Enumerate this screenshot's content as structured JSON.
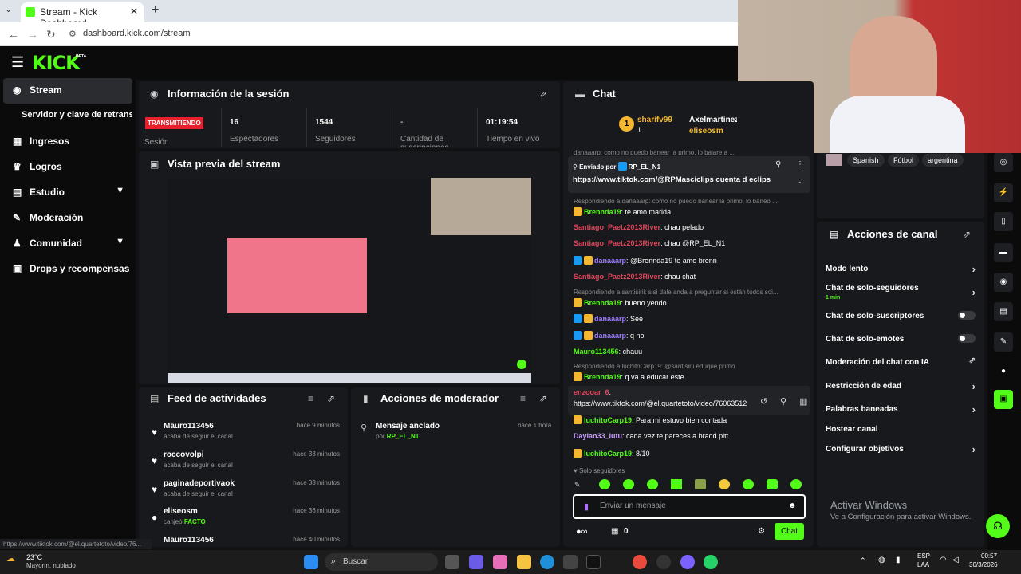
{
  "browser": {
    "tab_title": "Stream - Kick Dashboard",
    "url": "dashboard.kick.com/stream",
    "new_tab": "+",
    "close": "✕"
  },
  "header": {
    "logo": "KICK",
    "beta": "BETA"
  },
  "sidebar": {
    "items": [
      {
        "label": "Stream",
        "icon": "broadcast-icon"
      },
      {
        "label": "Servidor y clave de retransn"
      },
      {
        "label": "Ingresos"
      },
      {
        "label": "Logros"
      },
      {
        "label": "Estudio"
      },
      {
        "label": "Moderación"
      },
      {
        "label": "Comunidad"
      },
      {
        "label": "Drops y recompensas"
      }
    ]
  },
  "session": {
    "title": "Información de la sesión",
    "status": "TRANSMITIENDO",
    "status_label": "Sesión",
    "viewers": "16",
    "viewers_label": "Espectadores",
    "followers": "1544",
    "followers_label": "Seguidores",
    "subs": "-",
    "subs_label": "Cantidad de suscripciones",
    "time": "01:19:54",
    "time_label": "Tiempo en vivo"
  },
  "preview": {
    "title": "Vista previa del stream"
  },
  "feed": {
    "title": "Feed de actividades",
    "items": [
      {
        "name": "Mauro113456",
        "sub": "acaba de seguir el canal",
        "time": "hace 9 minutos"
      },
      {
        "name": "roccovolpi",
        "sub": "acaba de seguir el canal",
        "time": "hace 33 minutos"
      },
      {
        "name": "paginadeportivaok",
        "sub": "acaba de seguir el canal",
        "time": "hace 33 minutos"
      },
      {
        "name": "eliseosm",
        "sub": "canjeó",
        "sub2": "FACTO",
        "time": "hace 36 minutos"
      },
      {
        "name": "Mauro113456",
        "sub": "",
        "time": "hace 40 minutos"
      }
    ]
  },
  "modactions": {
    "title": "Acciones de moderador",
    "pinned": "Mensaje anclado",
    "by": "por",
    "by_user": "RP_EL_N1",
    "time": "hace 1 hora"
  },
  "chat": {
    "title": "Chat",
    "top1": "sharifv99",
    "top1_count": "1",
    "top2": "Axelmartinezr",
    "top3": "eliseosm",
    "pinned_by": "Enviado por",
    "pinned_user": "RP_EL_N1",
    "pinned_link": "https://www.tiktok.com/@RPMasciclips",
    "pinned_text": "cuenta d eclips",
    "truncated_top": "danaaarp: como no puedo banear la primo, lo bajare a ...",
    "messages": [
      {
        "type": "reply",
        "text": "Respondiendo a danaaarp: como no puedo banear la primo, lo baneo ..."
      },
      {
        "user": "Brennda19",
        "color": "#53fc18",
        "text": "te amo marida",
        "badges": "crown"
      },
      {
        "user": "Santiago_Paetz2013River",
        "color": "#e0455b",
        "text": "chau pelado"
      },
      {
        "user": "Santiago_Paetz2013River",
        "color": "#e0455b",
        "text": "chau @RP_EL_N1"
      },
      {
        "user": "danaaarp",
        "color": "#9d7cff",
        "text": "@Brennda19 te amo brenn",
        "badges": "both"
      },
      {
        "user": "Santiago_Paetz2013River",
        "color": "#e0455b",
        "text": "chau chat"
      },
      {
        "type": "reply",
        "text": "Respondiendo a santisirii: sisi dale anda a preguntar si están todos soi..."
      },
      {
        "user": "Brennda19",
        "color": "#53fc18",
        "text": "bueno yendo",
        "badges": "crown"
      },
      {
        "user": "danaaarp",
        "color": "#9d7cff",
        "text": "See",
        "badges": "both"
      },
      {
        "user": "danaaarp",
        "color": "#9d7cff",
        "text": "q no",
        "badges": "both"
      },
      {
        "user": "Mauro113456",
        "color": "#53fc18",
        "text": "chauu"
      },
      {
        "type": "reply",
        "text": "Respondiendo a luchitoCarp19: @santisirii eduque primo"
      },
      {
        "user": "Brennda19",
        "color": "#53fc18",
        "text": "q va a educar este",
        "badges": "crown"
      },
      {
        "user": "enzooar_6",
        "color": "#e0455b",
        "text": ""
      },
      {
        "type": "link",
        "text": "https://www.tiktok.com/@el.quartetoto/video/76063512"
      },
      {
        "user": "luchitoCarp19",
        "color": "#53fc18",
        "text": "Para mi estuvo bien contada",
        "badges": "crown"
      },
      {
        "user": "Daylan33_iutu",
        "color": "#c79cff",
        "text": "cada vez te pareces a bradd pitt"
      },
      {
        "user": "luchitoCarp19",
        "color": "#53fc18",
        "text": "8/10",
        "badges": "crown"
      }
    ],
    "followers_only": "Solo seguidores",
    "placeholder": "Enviar un mensaje",
    "points": "0",
    "send": "Chat"
  },
  "tags": [
    "Spanish",
    "Fútbol",
    "argentina"
  ],
  "channel_actions": {
    "title": "Acciones de canal",
    "items": [
      {
        "label": "Modo lento",
        "ctrl": "chevron"
      },
      {
        "label": "Chat de solo-seguidores",
        "sub": "1 min",
        "ctrl": "chevron"
      },
      {
        "label": "Chat de solo-suscriptores",
        "ctrl": "toggle"
      },
      {
        "label": "Chat de solo-emotes",
        "ctrl": "toggle"
      },
      {
        "label": "Moderación del chat con IA",
        "ctrl": "ext"
      },
      {
        "label": "Restricción de edad",
        "ctrl": "chevron"
      },
      {
        "label": "Palabras baneadas",
        "ctrl": "chevron"
      },
      {
        "label": "Hostear canal",
        "ctrl": "none"
      },
      {
        "label": "Configurar objetivos",
        "ctrl": "chevron"
      }
    ]
  },
  "windows": {
    "activate_title": "Activar Windows",
    "activate_sub": "Ve a Configuración para activar Windows.",
    "weather_temp": "23°C",
    "weather_desc": "Mayorm. nublado",
    "search": "Buscar",
    "lang1": "ESP",
    "lang2": "LAA",
    "clock_time": "00:57",
    "clock_date": "30/3/2026",
    "statusbar_url": "https://www.tiktok.com/@el.quartetoto/video/76..."
  },
  "colors": {
    "accent": "#53fc18",
    "live": "#e8202b",
    "panel": "#18191c"
  }
}
